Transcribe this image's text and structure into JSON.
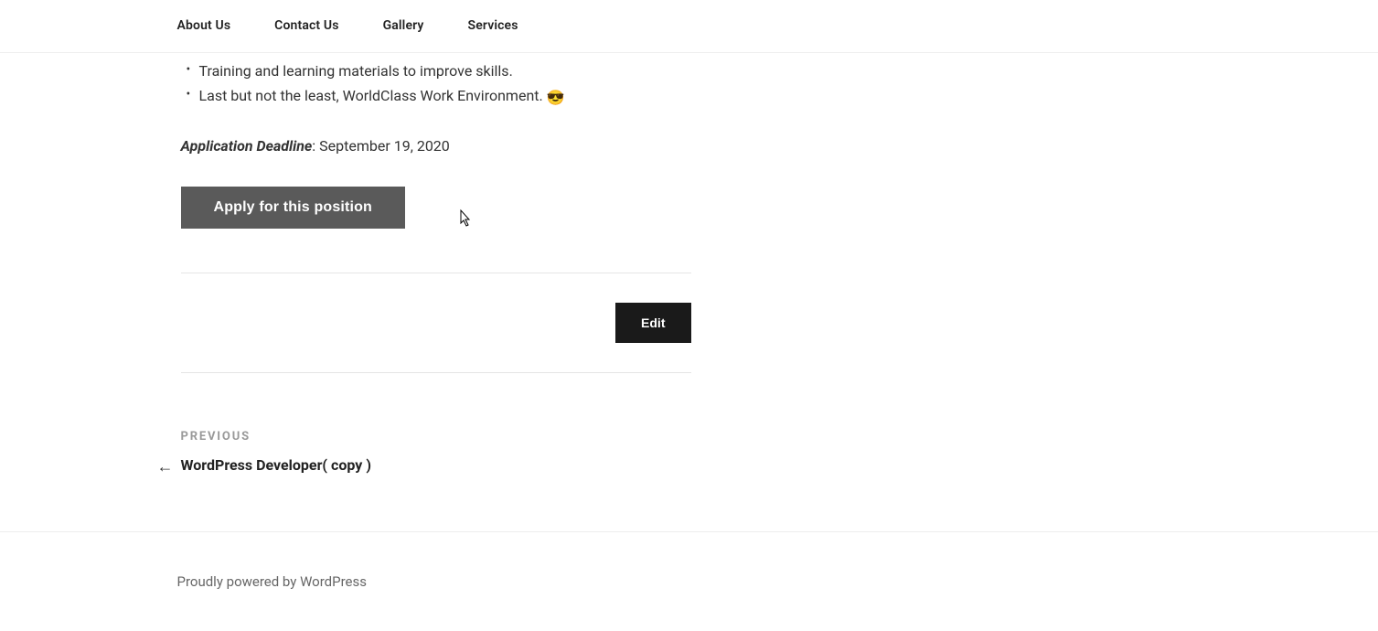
{
  "nav": {
    "items": [
      {
        "label": "About Us"
      },
      {
        "label": "Contact Us"
      },
      {
        "label": "Gallery"
      },
      {
        "label": "Services"
      }
    ]
  },
  "bullets": [
    {
      "text": "Training and learning materials to improve skills.",
      "emoji": ""
    },
    {
      "text": "Last but not the least, WorldClass Work Environment. ",
      "emoji": "😎"
    }
  ],
  "deadline": {
    "label": "Application Deadline",
    "value": ": September 19, 2020"
  },
  "apply_button": "Apply for this position",
  "edit_button": "Edit",
  "prev_nav": {
    "label": "PREVIOUS",
    "title": "WordPress Developer( copy )",
    "arrow": "←"
  },
  "footer": {
    "text": "Proudly powered by WordPress"
  }
}
